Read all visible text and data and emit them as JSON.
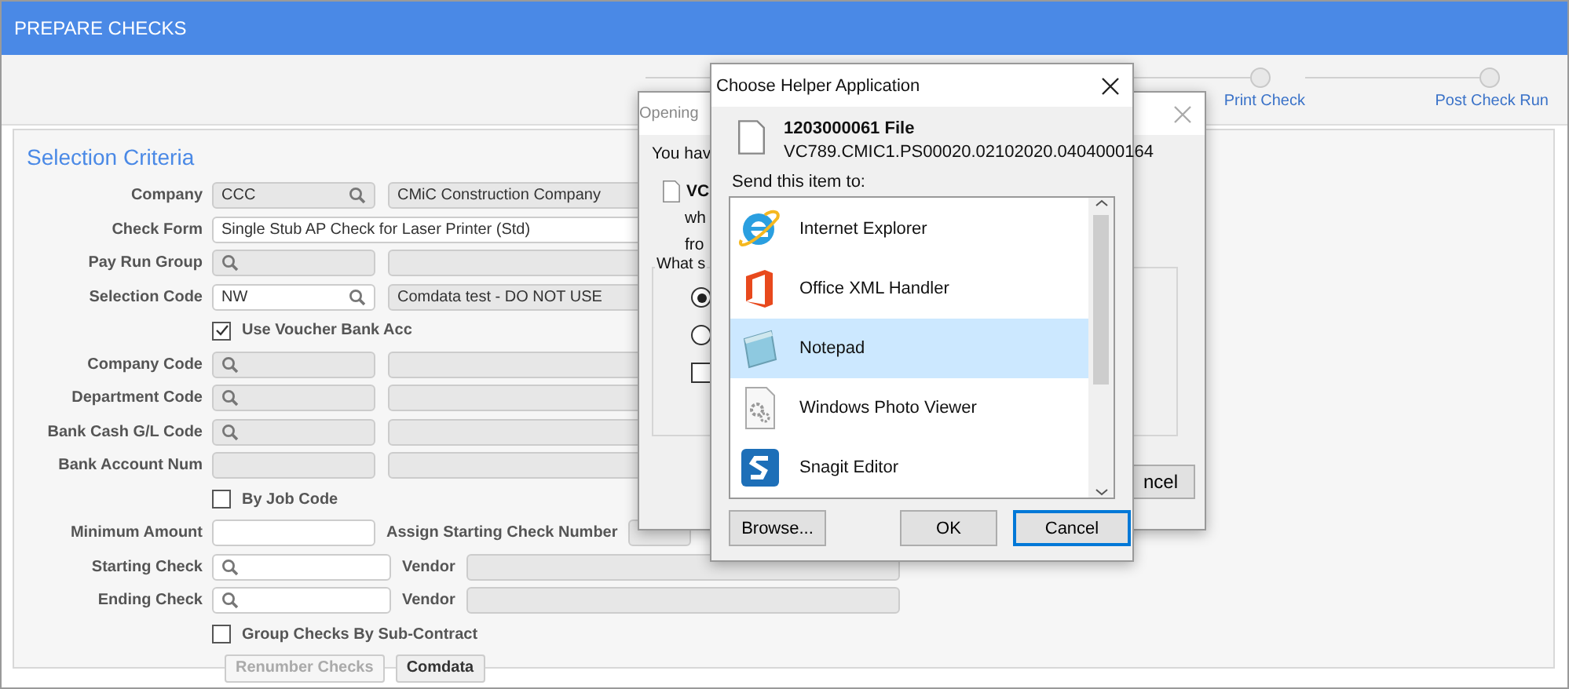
{
  "header": {
    "title": "PREPARE CHECKS"
  },
  "steps": [
    {
      "label": "Print Check"
    },
    {
      "label": "Post Check Run"
    }
  ],
  "form": {
    "title": "Selection Criteria",
    "rows": [
      {
        "kind": "pair",
        "label": "Company",
        "fields": [
          {
            "value": "CCC",
            "disabled": true,
            "lookup": true
          },
          {
            "value": "CMiC Construction Company",
            "disabled": true,
            "lookup": false
          }
        ]
      },
      {
        "kind": "single",
        "label": "Check Form",
        "fields": [
          {
            "value": "Single Stub AP Check for Laser Printer (Std)",
            "disabled": false
          }
        ]
      },
      {
        "kind": "pair",
        "label": "Pay Run Group",
        "fields": [
          {
            "disabled": true,
            "lookup": true
          },
          {
            "disabled": true,
            "lookup": false
          }
        ]
      },
      {
        "kind": "pair",
        "label": "Selection Code",
        "fields": [
          {
            "value": "NW",
            "disabled": false,
            "lookup": true
          },
          {
            "value": "Comdata test - DO NOT USE",
            "disabled": true,
            "lookup": false
          }
        ]
      },
      {
        "kind": "check",
        "label": "Use Voucher Bank Acc",
        "checked": true
      },
      {
        "kind": "pair",
        "label": "Company Code",
        "fields": [
          {
            "disabled": true,
            "lookup": true
          },
          {
            "disabled": true,
            "lookup": false
          }
        ]
      },
      {
        "kind": "pair",
        "label": "Department Code",
        "fields": [
          {
            "disabled": true,
            "lookup": true
          },
          {
            "disabled": true,
            "lookup": false
          }
        ]
      },
      {
        "kind": "pair",
        "label": "Bank Cash G/L Code",
        "fields": [
          {
            "disabled": true,
            "lookup": true
          },
          {
            "disabled": true,
            "lookup": false
          }
        ]
      },
      {
        "kind": "pair",
        "label": "Bank Account Num",
        "fields": [
          {
            "disabled": true,
            "lookup": false
          },
          {
            "disabled": true,
            "lookup": false
          }
        ]
      },
      {
        "kind": "check",
        "label": "By Job Code",
        "checked": false
      },
      {
        "kind": "amount",
        "label": "Minimum Amount",
        "fields": [
          {
            "disabled": false,
            "lookup": false
          },
          {
            "label": "Assign Starting Check Number",
            "disabled": true,
            "lookup": false
          }
        ]
      },
      {
        "kind": "vendor",
        "label": "Starting Check",
        "fields": [
          {
            "disabled": false,
            "lookup": true
          },
          {
            "label": "Vendor",
            "disabled": true,
            "lookup": false
          }
        ]
      },
      {
        "kind": "vendor",
        "label": "Ending Check",
        "fields": [
          {
            "disabled": false,
            "lookup": true
          },
          {
            "label": "Vendor",
            "disabled": true,
            "lookup": false
          }
        ]
      },
      {
        "kind": "check",
        "label": "Group Checks By Sub-Contract",
        "checked": false
      },
      {
        "kind": "buttons",
        "buttons": [
          {
            "label": "Renumber Checks",
            "disabled": true
          },
          {
            "label": "Comdata",
            "disabled": false
          }
        ]
      }
    ]
  },
  "opening_dialog": {
    "title": "Opening",
    "intro": "You hav",
    "file_name": "VC",
    "line_1": "wh",
    "line_2": "fro",
    "group_label": "What s",
    "options": [
      {
        "kind": "radio",
        "selected": true
      },
      {
        "kind": "radio",
        "selected": false
      },
      {
        "kind": "checkbox",
        "checked": false
      }
    ],
    "button": "ncel"
  },
  "helper_dialog": {
    "title": "Choose Helper Application",
    "file_title": "1203000061 File",
    "file_path": "VC789.CMIC1.PS00020.02102020.0404000164",
    "prompt": "Send this item to:",
    "apps": [
      {
        "label": "Internet Explorer",
        "selected": false
      },
      {
        "label": "Office XML Handler",
        "selected": false
      },
      {
        "label": "Notepad",
        "selected": true
      },
      {
        "label": "Windows Photo Viewer",
        "selected": false
      },
      {
        "label": "Snagit Editor",
        "selected": false
      }
    ],
    "buttons": [
      {
        "label": "Browse...",
        "default": false
      },
      {
        "label": "OK",
        "default": false
      },
      {
        "label": "Cancel",
        "default": true
      }
    ]
  }
}
